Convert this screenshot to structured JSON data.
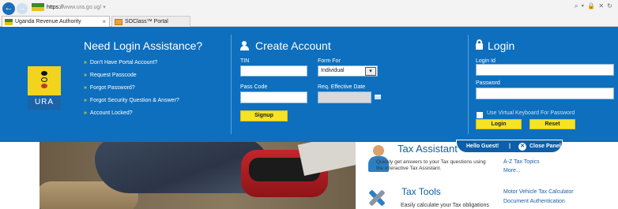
{
  "browser": {
    "url_protocol": "https://",
    "url_host": "www.ura.go.ug/",
    "url_pin": "▾",
    "toolbar_icons": "⌕ ▾ 🔒 ✕ ↻",
    "nav_back": "←",
    "nav_forward": "→",
    "tabs": [
      {
        "label": "Uganda Revenue Authority",
        "close": "×"
      },
      {
        "label": "SOClass™ Portal"
      }
    ]
  },
  "logo": {
    "text": "URA"
  },
  "assistance": {
    "title": "Need Login Assistance?",
    "chevron": "»",
    "items": [
      "Don't Have Portal Account?",
      "Request Passcode",
      "Forgot Password?",
      "Forgot Security Question & Answer?",
      "Account Locked?"
    ]
  },
  "create_account": {
    "title": "Create Account",
    "tin_label": "TIN",
    "tin_value": "",
    "form_for_label": "Form For",
    "form_for_value": "Individual",
    "form_for_arrow": "▾",
    "pass_code_label": "Pass Code",
    "pass_code_value": "",
    "req_effective_date_label": "Req. Effective Date",
    "req_effective_date_value": "",
    "signup_label": "Signup"
  },
  "login": {
    "title": "Login",
    "login_id_label": "Login Id",
    "login_id_value": "",
    "password_label": "Password",
    "password_value": "",
    "virtual_keyboard_label": "Use Virtual Keyboard For Password",
    "login_button": "Login",
    "reset_button": "Reset"
  },
  "panel": {
    "greeting": "Hello Guest!",
    "separator": "|",
    "close_icon": "✕",
    "close_label": "Close Panel"
  },
  "tax_assistant": {
    "title": "Tax Assistant",
    "description": "Quickly get answers to your Tax questions using the Interactive Tax Assistant.",
    "az_topics": "A-Z Tax Topics",
    "more": "More..."
  },
  "tax_tools": {
    "title": "Tax Tools",
    "description": "Easily calculate your Tax obligations",
    "motor_vehicle": "Motor Vehicle Tax Calculator",
    "doc_auth": "Document Authentication"
  }
}
